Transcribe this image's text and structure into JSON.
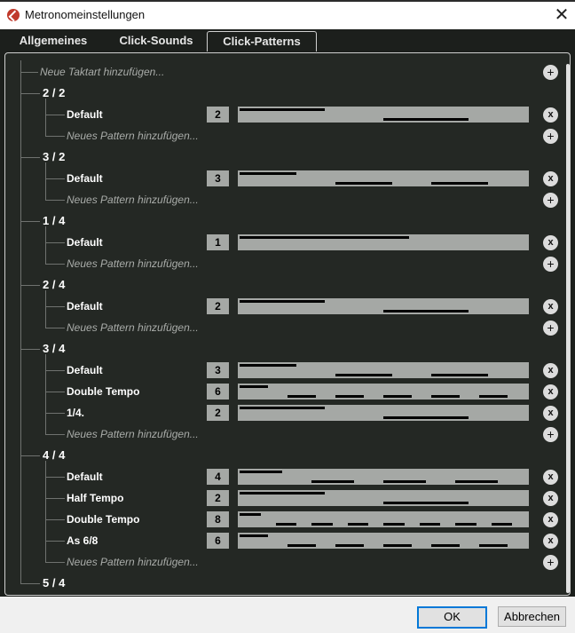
{
  "window": {
    "title": "Metronomeinstellungen"
  },
  "tabs": [
    {
      "label": "Allgemeines"
    },
    {
      "label": "Click-Sounds"
    },
    {
      "label": "Click-Patterns"
    }
  ],
  "add_time_signature_label": "Neue Taktart hinzufügen...",
  "add_pattern_label": "Neues Pattern hinzufügen...",
  "groups": [
    {
      "signature": "2 / 2",
      "patterns": [
        {
          "name": "Default",
          "count": "2"
        }
      ]
    },
    {
      "signature": "3 / 2",
      "patterns": [
        {
          "name": "Default",
          "count": "3"
        }
      ]
    },
    {
      "signature": "1 / 4",
      "patterns": [
        {
          "name": "Default",
          "count": "1"
        }
      ]
    },
    {
      "signature": "2 / 4",
      "patterns": [
        {
          "name": "Default",
          "count": "2"
        }
      ]
    },
    {
      "signature": "3 / 4",
      "patterns": [
        {
          "name": "Default",
          "count": "3"
        },
        {
          "name": "Double Tempo",
          "count": "6"
        },
        {
          "name": "1/4.",
          "count": "2"
        }
      ]
    },
    {
      "signature": "4 / 4",
      "patterns": [
        {
          "name": "Default",
          "count": "4"
        },
        {
          "name": "Half Tempo",
          "count": "2"
        },
        {
          "name": "Double Tempo",
          "count": "8"
        },
        {
          "name": "As 6/8",
          "count": "6"
        }
      ]
    },
    {
      "signature": "5 / 4",
      "patterns": []
    }
  ],
  "icons": {
    "add": "plus-circle-icon",
    "remove": "x-circle-icon",
    "close": "close-icon",
    "app": "cubase-logo-icon"
  },
  "buttons": {
    "ok": "OK",
    "cancel": "Abbrechen"
  },
  "colors": {
    "panel_bg": "#242824",
    "pattern_bar": "#a5a8a5",
    "accent_button": "#0078d7"
  }
}
